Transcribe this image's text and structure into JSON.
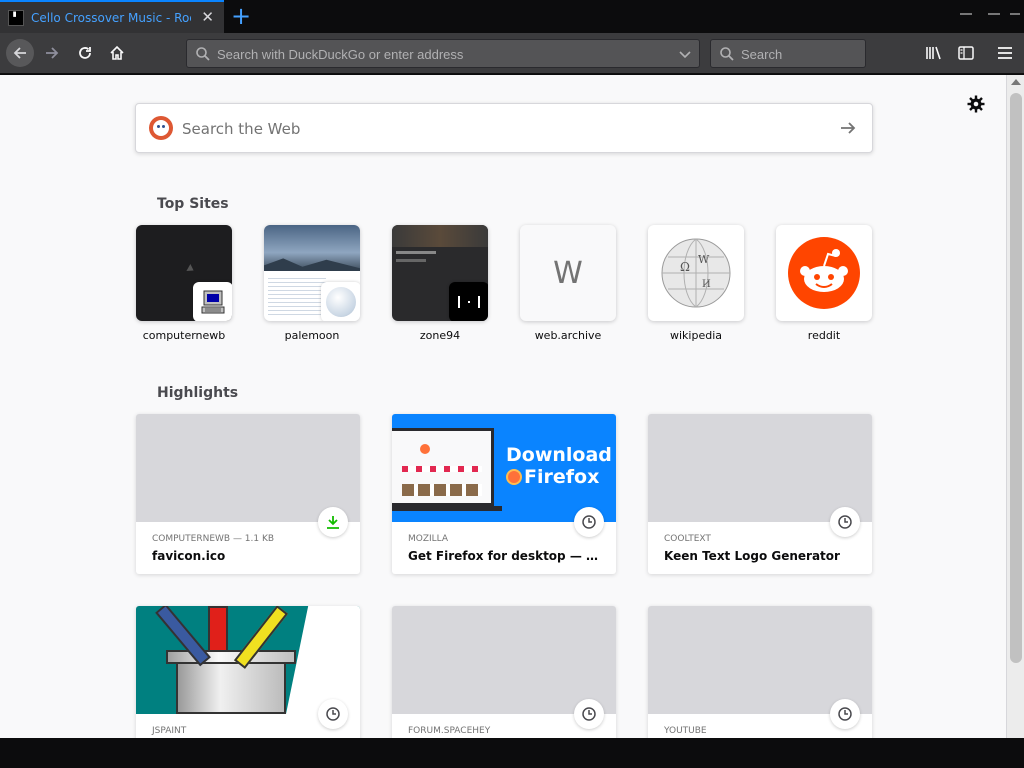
{
  "browser": {
    "tab": {
      "title": "Cello Crossover Music - Rock",
      "favicon_text": "▘"
    },
    "url_placeholder": "Search with DuckDuckGo or enter address",
    "search_placeholder": "Search"
  },
  "newtab": {
    "web_search_placeholder": "Search the Web",
    "top_sites_title": "Top Sites",
    "top_sites": [
      {
        "label": "computernewb"
      },
      {
        "label": "palemoon"
      },
      {
        "label": "zone94"
      },
      {
        "label": "web.archive",
        "letter": "W"
      },
      {
        "label": "wikipedia"
      },
      {
        "label": "reddit"
      }
    ],
    "highlights_title": "Highlights",
    "highlights": [
      {
        "source": "COMPUTERNEWB — 1.1 KB",
        "title": "favicon.ico",
        "icon": "download-icon"
      },
      {
        "source": "MOZILLA",
        "title": "Get Firefox for desktop — Mozil...",
        "icon": "clock-icon",
        "banner_line1": "Download",
        "banner_line2": "Firefox"
      },
      {
        "source": "COOLTEXT",
        "title": "Keen Text Logo Generator",
        "icon": "clock-icon"
      },
      {
        "source": "JSPAINT",
        "title": "",
        "icon": "clock-icon"
      },
      {
        "source": "FORUM.SPACEHEY",
        "title": "",
        "icon": "clock-icon"
      },
      {
        "source": "YOUTUBE",
        "title": "",
        "icon": "clock-icon"
      }
    ]
  },
  "colors": {
    "accent": "#0a84ff",
    "reddit": "#ff4500",
    "download": "#12bc00",
    "firefox_banner": "#0a84ff"
  }
}
